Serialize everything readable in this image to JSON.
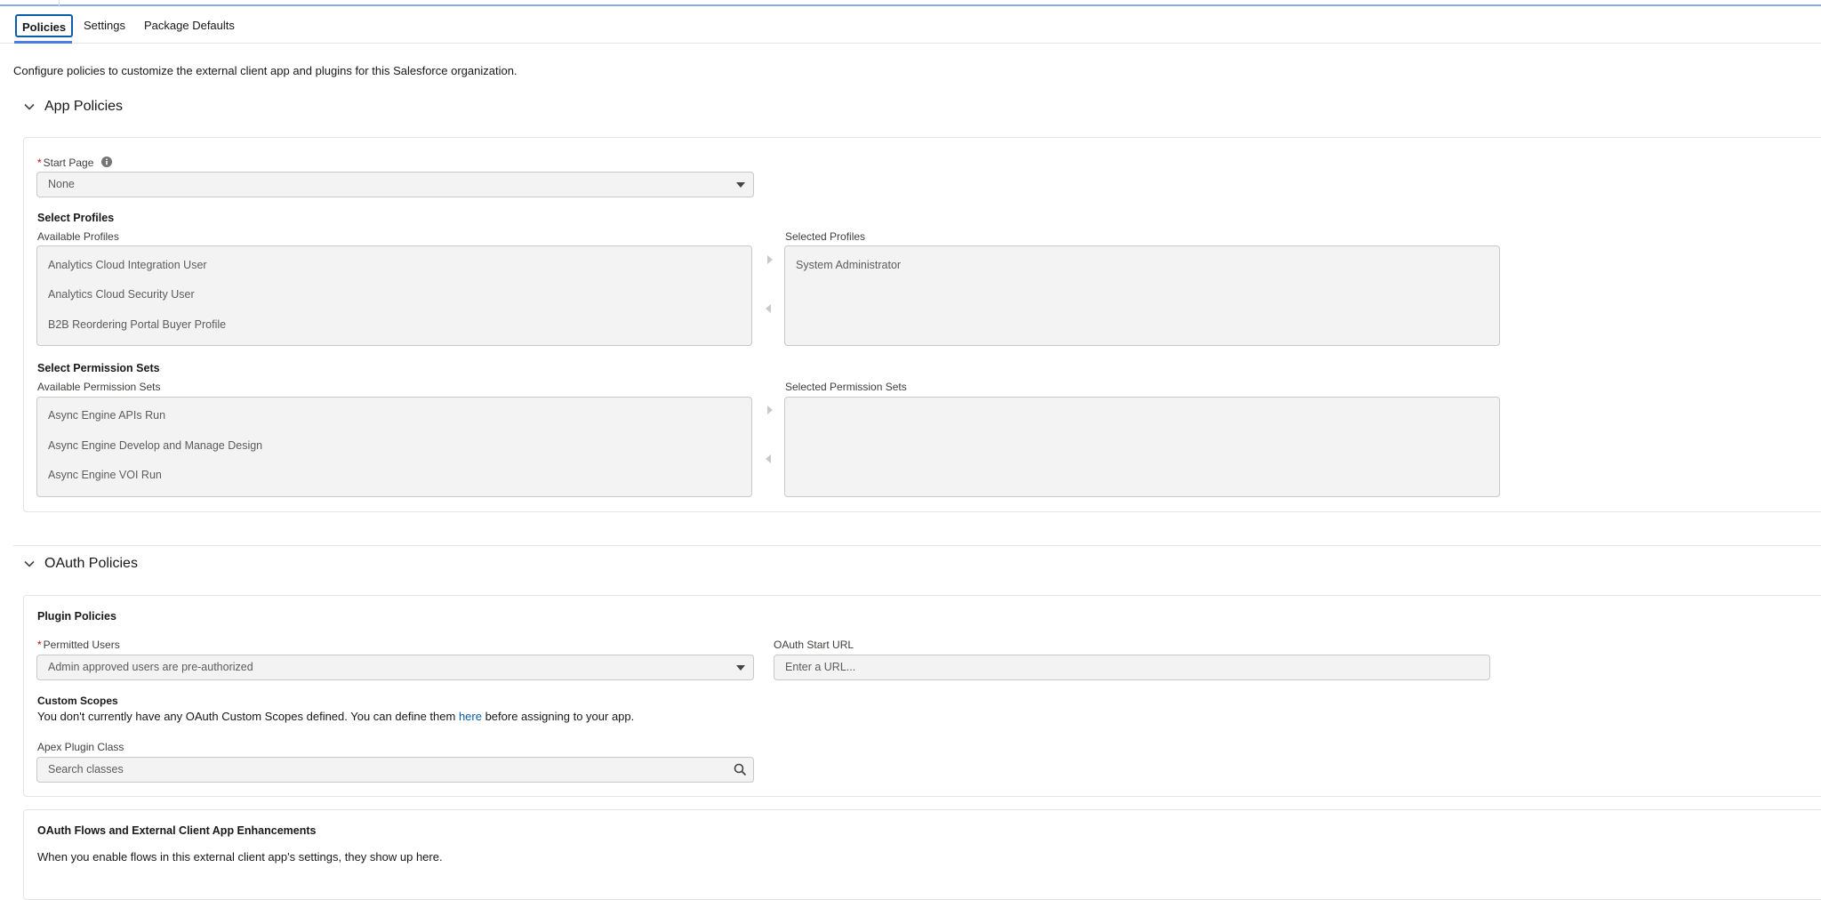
{
  "tabs": [
    {
      "label": "Policies",
      "active": true
    },
    {
      "label": "Settings",
      "active": false
    },
    {
      "label": "Package Defaults",
      "active": false
    }
  ],
  "intro": "Configure policies to customize the external client app and plugins for this Salesforce organization.",
  "app_policies": {
    "title": "App Policies",
    "start_page": {
      "required_mark": "*",
      "label": "Start Page",
      "value": "None"
    },
    "profiles": {
      "heading": "Select Profiles",
      "available_label": "Available Profiles",
      "selected_label": "Selected Profiles",
      "available": [
        "Analytics Cloud Integration User",
        "Analytics Cloud Security User",
        "B2B Reordering Portal Buyer Profile"
      ],
      "selected": [
        "System Administrator"
      ]
    },
    "permission_sets": {
      "heading": "Select Permission Sets",
      "available_label": "Available Permission Sets",
      "selected_label": "Selected Permission Sets",
      "available": [
        "Async Engine APIs Run",
        "Async Engine Develop and Manage Design",
        "Async Engine VOI Run"
      ],
      "selected": []
    }
  },
  "oauth_policies": {
    "title": "OAuth Policies",
    "plugin_heading": "Plugin Policies",
    "permitted_users": {
      "required_mark": "*",
      "label": "Permitted Users",
      "value": "Admin approved users are pre-authorized"
    },
    "oauth_start_url": {
      "label": "OAuth Start URL",
      "placeholder": "Enter a URL..."
    },
    "custom_scopes": {
      "heading": "Custom Scopes",
      "text_before": "You don't currently have any OAuth Custom Scopes defined. You can define them ",
      "link": "here",
      "text_after": " before assigning to your app."
    },
    "apex_plugin": {
      "label": "Apex Plugin Class",
      "placeholder": "Search classes"
    }
  },
  "flows": {
    "heading": "OAuth Flows and External Client App Enhancements",
    "text": "When you enable flows in this external client app's settings, they show up here."
  },
  "colors": {
    "accent": "#0b5cab",
    "required": "#ba0517",
    "field_bg": "#f3f3f3"
  }
}
